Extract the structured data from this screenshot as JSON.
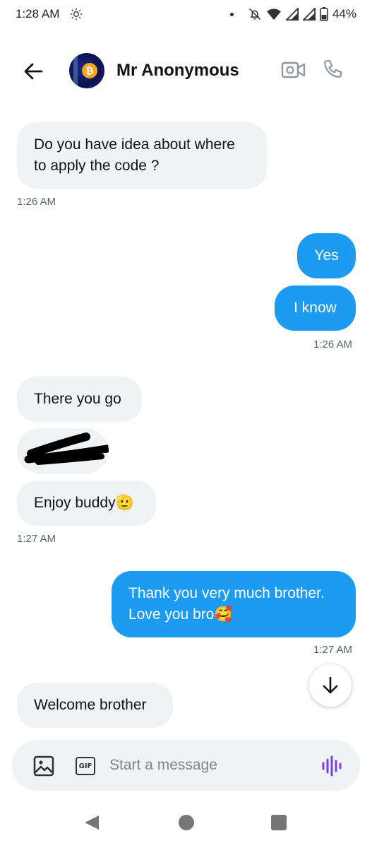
{
  "status_bar": {
    "time": "1:28 AM",
    "battery": "44%",
    "icons": [
      "settings-gear-icon",
      "notification-dot",
      "bell-off-icon",
      "wifi-icon",
      "signal-icon",
      "signal-icon",
      "battery-icon"
    ]
  },
  "header": {
    "back_icon": "arrow-left-icon",
    "contact_name": "Mr Anonymous",
    "video_icon": "video-camera-icon",
    "call_icon": "phone-icon"
  },
  "messages": [
    {
      "side": "received",
      "text": "Do you have idea about where to apply the code ?"
    },
    {
      "side": "received_time",
      "text": "1:26 AM"
    },
    {
      "side": "sent",
      "text": "Yes"
    },
    {
      "side": "sent",
      "text": "I know"
    },
    {
      "side": "sent_time",
      "text": "1:26 AM"
    },
    {
      "side": "received",
      "text": "There you go"
    },
    {
      "side": "received",
      "text": "Enjoy buddy🫡"
    },
    {
      "side": "received_time",
      "text": "1:27 AM"
    },
    {
      "side": "sent",
      "text": "Thank you very much brother. Love you bro🥰"
    },
    {
      "side": "sent_time",
      "text": "1:27 AM"
    },
    {
      "side": "received",
      "text": "Welcome brother"
    }
  ],
  "composer": {
    "placeholder": "Start a message",
    "gif_label": "GIF",
    "media_icon": "image-icon",
    "voice_icon": "voice-wave-icon"
  },
  "colors": {
    "sent_bubble": "#1d9bf0",
    "received_bubble": "#eff3f4",
    "voice_accent": "#7b3fe4"
  }
}
